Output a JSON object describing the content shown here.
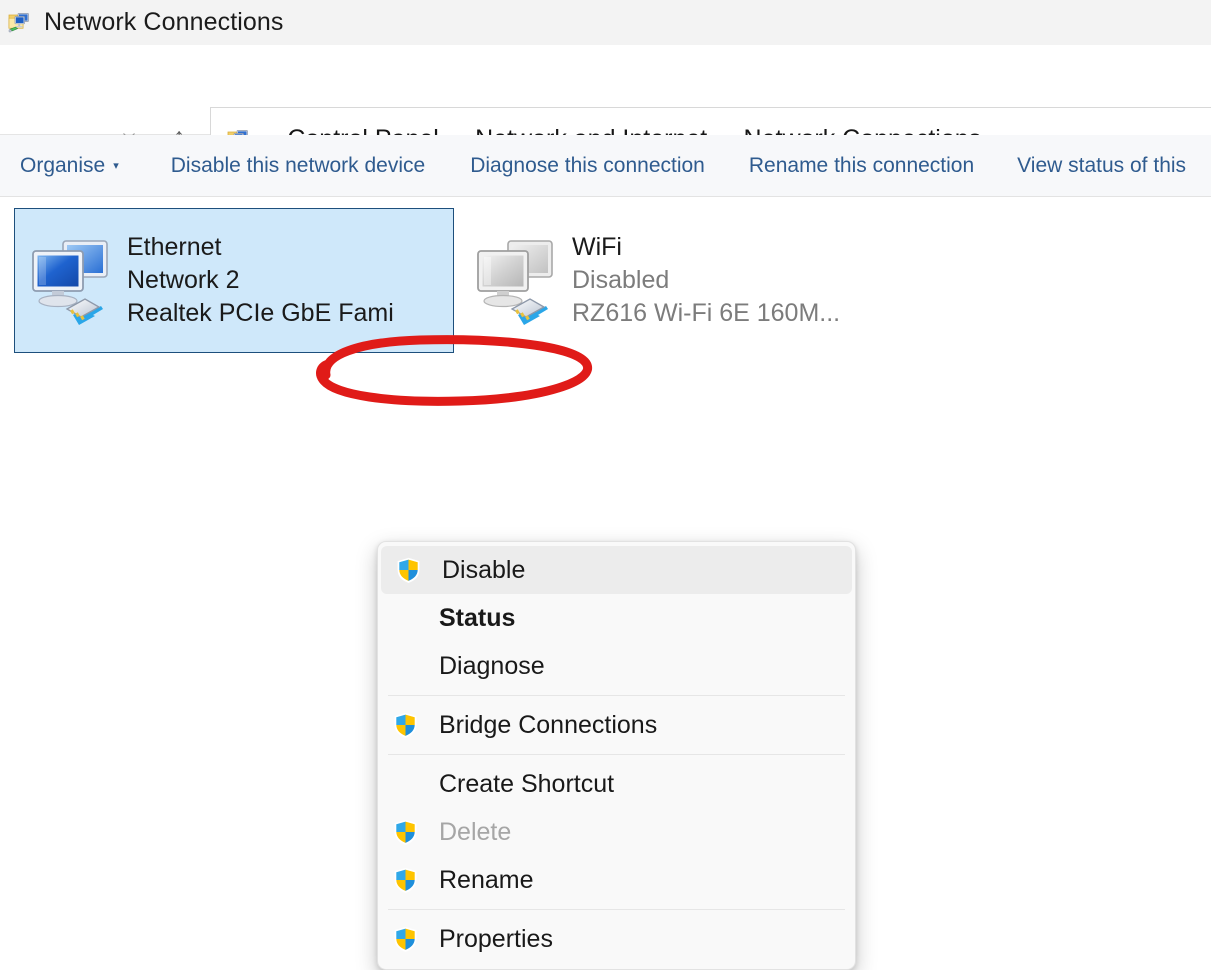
{
  "window": {
    "title": "Network Connections",
    "icon": "network-connections-folder-icon"
  },
  "nav": {
    "back_icon": "←",
    "forward_icon": "→",
    "recent_icon": "⌄",
    "up_icon": "↑",
    "address_icon": "network-connections-folder-icon",
    "separator": "›",
    "breadcrumbs": [
      {
        "label": "Control Panel"
      },
      {
        "label": "Network and Internet"
      },
      {
        "label": "Network Connections"
      }
    ]
  },
  "command_bar": {
    "items": [
      {
        "label": "Organise",
        "has_caret": true
      },
      {
        "label": "Disable this network device",
        "has_caret": false
      },
      {
        "label": "Diagnose this connection",
        "has_caret": false
      },
      {
        "label": "Rename this connection",
        "has_caret": false
      },
      {
        "label": "View status of this",
        "has_caret": false
      }
    ],
    "caret_glyph": "▾"
  },
  "connections": [
    {
      "name": "Ethernet",
      "status": "Network 2",
      "device": "Realtek PCIe GbE Fami",
      "selected": true,
      "icon": "network-adapter-icon"
    },
    {
      "name": "WiFi",
      "status": "Disabled",
      "device": "RZ616 Wi-Fi 6E 160M...",
      "selected": false,
      "icon": "network-adapter-disabled-icon"
    }
  ],
  "context_menu": {
    "items": [
      {
        "label": "Disable",
        "shield": true,
        "bold": false,
        "disabled": false,
        "hover": true,
        "separator_after": false
      },
      {
        "label": "Status",
        "shield": false,
        "bold": true,
        "disabled": false,
        "hover": false,
        "separator_after": false
      },
      {
        "label": "Diagnose",
        "shield": false,
        "bold": false,
        "disabled": false,
        "hover": false,
        "separator_after": true
      },
      {
        "label": "Bridge Connections",
        "shield": true,
        "bold": false,
        "disabled": false,
        "hover": false,
        "separator_after": true
      },
      {
        "label": "Create Shortcut",
        "shield": false,
        "bold": false,
        "disabled": false,
        "hover": false,
        "separator_after": false
      },
      {
        "label": "Delete",
        "shield": true,
        "bold": false,
        "disabled": true,
        "hover": false,
        "separator_after": false
      },
      {
        "label": "Rename",
        "shield": true,
        "bold": false,
        "disabled": false,
        "hover": false,
        "separator_after": true
      },
      {
        "label": "Properties",
        "shield": true,
        "bold": false,
        "disabled": false,
        "hover": false,
        "separator_after": false
      }
    ]
  },
  "annotation": {
    "shape": "red-ellipse-highlight",
    "target": "Disable",
    "color": "#e01b18"
  },
  "colors": {
    "selection_fill": "#cfe8fa",
    "selection_border": "#1d4f7c",
    "command_link": "#2f5b8f",
    "titlebar_bg": "#f3f3f3",
    "commandbar_bg": "#f7f8fa",
    "menu_bg": "#f9f9f9",
    "menu_hover": "#ececec",
    "disabled_text": "#a6a6a6",
    "annotation_red": "#e01b18"
  }
}
